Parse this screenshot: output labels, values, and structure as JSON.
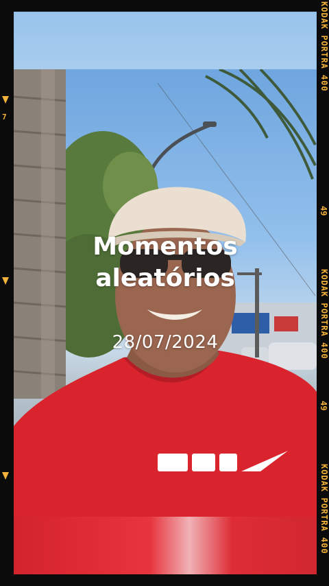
{
  "overlay": {
    "title_line1": "Momentos",
    "title_line2": "aleatórios",
    "date": "28/07/2024"
  },
  "film": {
    "brand_label": "KODAK PORTRA 400",
    "frame_number": "49",
    "left_frame_number": "7"
  },
  "colors": {
    "film_text": "#f3b23a",
    "shirt_red": "#d9232d",
    "cap": "#eadfd0"
  },
  "shirt_logo": "NIKE"
}
